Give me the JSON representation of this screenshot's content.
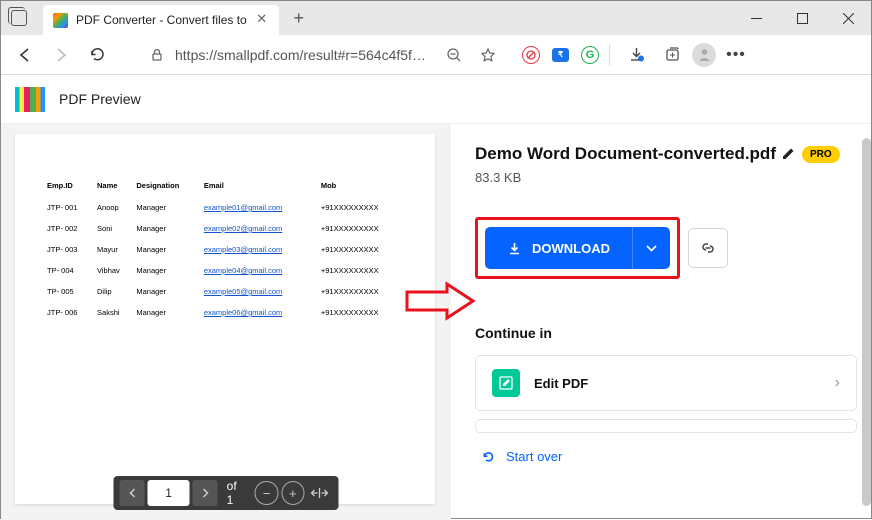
{
  "window": {
    "tab_title": "PDF Converter - Convert files to ",
    "url": "https://smallpdf.com/result#r=564c4f5f7…"
  },
  "app": {
    "header_title": "PDF Preview"
  },
  "preview": {
    "headers": [
      "Emp.ID",
      "Name",
      "Designation",
      "Email",
      "Mob"
    ],
    "rows": [
      {
        "id": "JTP- 001",
        "name": "Anoop",
        "role": "Manager",
        "email": "example01@gmail.com",
        "mob": "+91XXXXXXXXX"
      },
      {
        "id": "JTP- 002",
        "name": "Soni",
        "role": "Manager",
        "email": "example02@gmail.com",
        "mob": "+91XXXXXXXXX"
      },
      {
        "id": "JTP- 003",
        "name": "Mayur",
        "role": "Manager",
        "email": "example03@gmail.com",
        "mob": "+91XXXXXXXXX"
      },
      {
        "id": "TP- 004",
        "name": "Vibhav",
        "role": "Manager",
        "email": "example04@gmail.com",
        "mob": "+91XXXXXXXXX"
      },
      {
        "id": "TP- 005",
        "name": "Dilip",
        "role": "Manager",
        "email": "example05@gmail.com",
        "mob": "+91XXXXXXXXX"
      },
      {
        "id": "JTP- 006",
        "name": "Sakshi",
        "role": "Manager",
        "email": "example06@gmail.com",
        "mob": "+91XXXXXXXXX"
      }
    ]
  },
  "page_tools": {
    "current": "1",
    "of_label": "of 1"
  },
  "right": {
    "file_title": "Demo Word Document-converted.pdf",
    "pro_label": "PRO",
    "file_size": "83.3 KB",
    "download_label": "DOWNLOAD",
    "continue_label": "Continue in",
    "edit_label": "Edit PDF",
    "start_over_label": "Start over"
  }
}
